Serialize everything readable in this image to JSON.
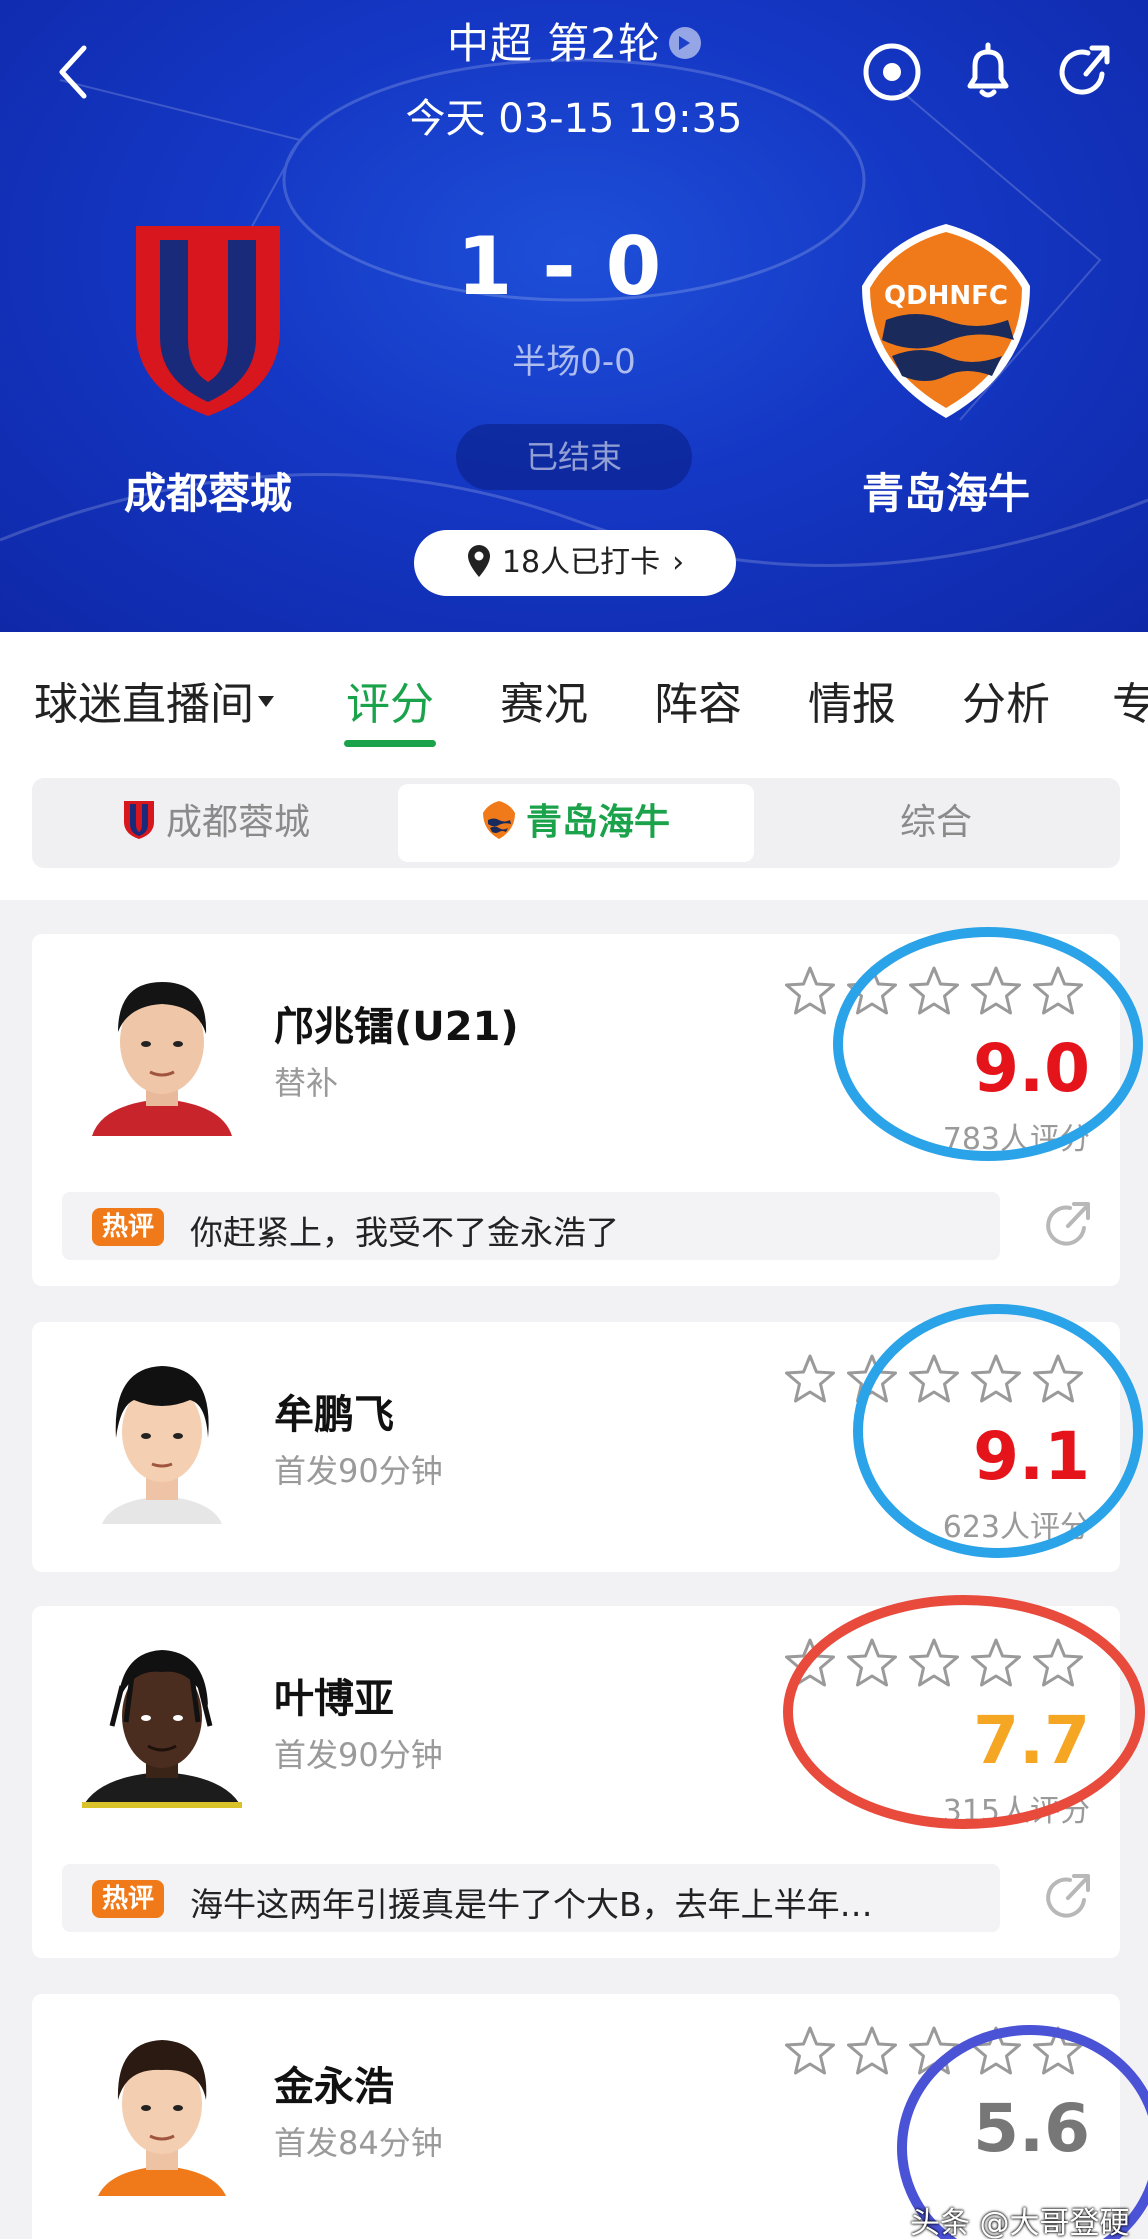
{
  "header": {
    "round": "中超 第2轮",
    "datetime": "今天 03-15 19:35",
    "home_team": "成都蓉城",
    "away_team": "青岛海牛",
    "score_home": "1",
    "score_sep": "-",
    "score_away": "0",
    "halftime": "半场0-0",
    "status": "已结束",
    "checkin": "18人已打卡",
    "colors": {
      "bg": "#1437c4",
      "accent": "#1aa34a"
    },
    "icons": [
      "back-icon",
      "live-icon",
      "bell-icon",
      "share-icon"
    ]
  },
  "tabs": {
    "items": [
      "球迷直播间",
      "评分",
      "赛况",
      "阵容",
      "情报",
      "分析",
      "专"
    ],
    "active": "评分"
  },
  "segment": {
    "items": [
      "成都蓉城",
      "青岛海牛",
      "综合"
    ],
    "active": "青岛海牛"
  },
  "players": [
    {
      "name": "邝兆镭(U21)",
      "role": "替补",
      "rating": "9.0",
      "rating_color": "#e5141b",
      "count": "783人评分",
      "stars": 5,
      "hot_badge": "热评",
      "hot_comment": "你赶紧上，我受不了金永浩了"
    },
    {
      "name": "牟鹏飞",
      "role": "首发90分钟",
      "rating": "9.1",
      "rating_color": "#e5141b",
      "count": "623人评分",
      "stars": 5
    },
    {
      "name": "叶博亚",
      "role": "首发90分钟",
      "rating": "7.7",
      "rating_color": "#f5a623",
      "count": "315人评分",
      "stars": 5,
      "hot_badge": "热评",
      "hot_comment": "海牛这两年引援真是牛了个大B，去年上半年…"
    },
    {
      "name": "金永浩",
      "role": "首发84分钟",
      "rating": "5.6",
      "rating_color": "#777777",
      "count": "",
      "stars": 5
    }
  ],
  "watermark": "头条 @大哥登硬"
}
